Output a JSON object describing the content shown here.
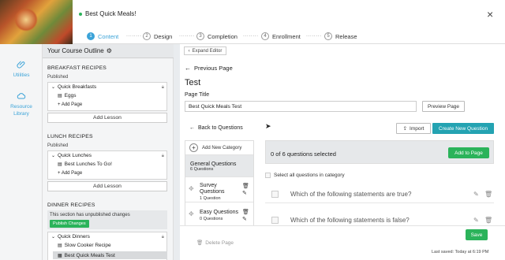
{
  "header": {
    "course_title": "Best Quick Meals!",
    "steps": [
      {
        "num": "1",
        "label": "Content",
        "active": true
      },
      {
        "num": "2",
        "label": "Design"
      },
      {
        "num": "3",
        "label": "Completion"
      },
      {
        "num": "4",
        "label": "Enrollment"
      },
      {
        "num": "5",
        "label": "Release"
      }
    ],
    "step_separator": "........",
    "close_icon": "×"
  },
  "rail": {
    "utilities": "Utilities",
    "resource_library": "Resource Library"
  },
  "outline": {
    "title": "Your Course Outline",
    "sections": [
      {
        "title": "BREAKFAST RECIPES",
        "status": "Published",
        "chapter": "Quick Breakfasts",
        "lessons": [
          "Eggs"
        ],
        "add_page": "+ Add Page",
        "add_lesson": "Add Lesson"
      },
      {
        "title": "LUNCH RECIPES",
        "status": "Published",
        "chapter": "Quick Lunches",
        "lessons": [
          "Best Lunches To Go!"
        ],
        "add_page": "+ Add Page",
        "add_lesson": "Add Lesson"
      },
      {
        "title": "DINNER RECIPES",
        "notice": "This section has unpublished changes",
        "publish_btn": "Publish Changes",
        "chapter": "Quick Dinners",
        "lessons": [
          "Slow Cooker Recipe",
          "Best Quick Meals Test"
        ]
      }
    ]
  },
  "editor": {
    "expand_editor": "Expand Editor",
    "previous_page": "Previous Page",
    "page_heading": "Test",
    "page_title_label": "Page Title",
    "page_title_value": "Best Quick Meals Test",
    "preview_page": "Preview Page",
    "back_to_questions": "Back to Questions",
    "import": "Import",
    "create_new_question": "Create New Question",
    "add_new_category": "Add New Category",
    "categories": [
      {
        "name": "General Questions",
        "count": "6 Questions"
      },
      {
        "name": "Survey Questions",
        "count": "1 Question"
      },
      {
        "name": "Easy Questions",
        "count": "0 Questions"
      }
    ],
    "selected_summary": "0 of 6 questions selected",
    "add_to_page": "Add to Page",
    "select_all": "Select all questions in category",
    "questions": [
      "Which of the following statements are true?",
      "Which of the following statements is false?"
    ],
    "delete_page": "Delete Page",
    "save": "Save",
    "last_saved": "Last saved: Today at 6:19 PM"
  }
}
